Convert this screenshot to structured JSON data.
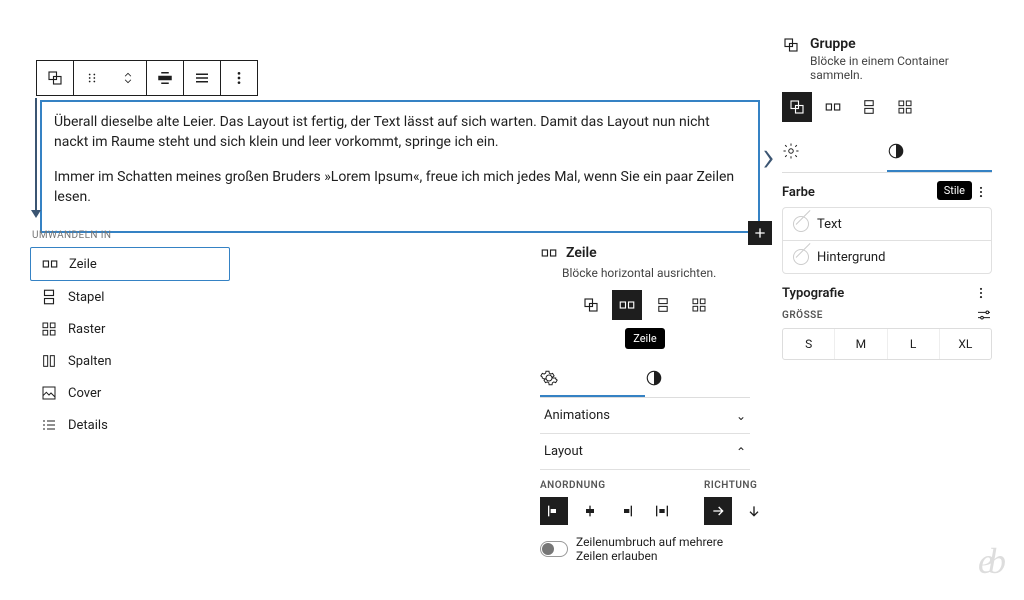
{
  "toolbar": {
    "buttons": [
      "group-icon",
      "drag-icon",
      "move-icon",
      "align-wide-icon",
      "justify-icon",
      "options-icon"
    ]
  },
  "block": {
    "para1": "Überall dieselbe alte Leier. Das Layout ist fertig, der Text lässt auf sich warten. Damit das Layout nun nicht nackt im Raume steht und sich klein und leer vorkommt, springe ich ein.",
    "para2": "Immer im Schatten meines großen Bruders »Lorem Ipsum«, freue ich mich jedes Mal, wenn Sie ein paar Zeilen lesen."
  },
  "transform": {
    "heading": "Umwandeln in",
    "items": [
      {
        "label": "Zeile",
        "icon": "row-icon",
        "selected": true
      },
      {
        "label": "Stapel",
        "icon": "stack-icon"
      },
      {
        "label": "Raster",
        "icon": "grid-icon"
      },
      {
        "label": "Spalten",
        "icon": "columns-icon"
      },
      {
        "label": "Cover",
        "icon": "cover-icon"
      },
      {
        "label": "Details",
        "icon": "details-icon"
      }
    ]
  },
  "pop_mid": {
    "title": "Zeile",
    "subtitle": "Blöcke horizontal ausrichten.",
    "tooltip": "Zeile",
    "tabs": {
      "settings": "settings",
      "styles": "styles"
    },
    "panels": {
      "animations": "Animations",
      "layout": "Layout"
    },
    "layout": {
      "anordnung": "Anordnung",
      "richtung": "Richtung"
    },
    "wrap_label": "Zeilenumbruch auf mehrere Zeilen erlauben"
  },
  "side": {
    "title": "Gruppe",
    "subtitle": "Blöcke in einem Container sammeln.",
    "stile_tooltip": "Stile",
    "color": {
      "heading": "Farbe",
      "text": "Text",
      "bg": "Hintergrund"
    },
    "typo": {
      "heading": "Typografie",
      "size_label": "Grösse",
      "sizes": [
        "S",
        "M",
        "L",
        "XL"
      ]
    }
  }
}
